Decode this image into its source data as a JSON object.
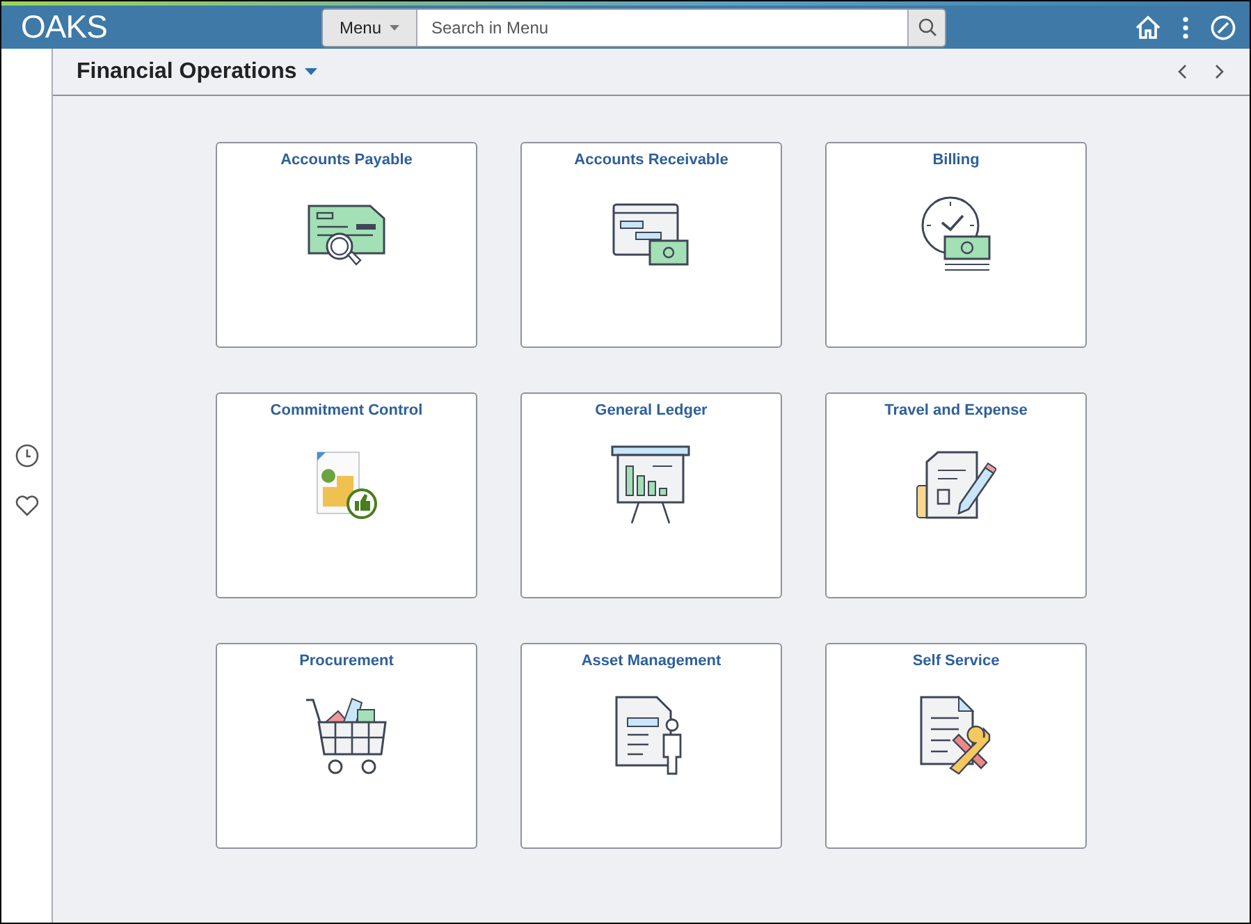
{
  "header": {
    "logo": "OAKS",
    "menu_button": "Menu",
    "search": {
      "placeholder": "Search in Menu"
    }
  },
  "page": {
    "title": "Financial Operations"
  },
  "tiles": [
    {
      "title": "Accounts Payable"
    },
    {
      "title": "Accounts Receivable"
    },
    {
      "title": "Billing"
    },
    {
      "title": "Commitment Control"
    },
    {
      "title": "General Ledger"
    },
    {
      "title": "Travel and Expense"
    },
    {
      "title": "Procurement"
    },
    {
      "title": "Asset Management"
    },
    {
      "title": "Self Service"
    }
  ]
}
